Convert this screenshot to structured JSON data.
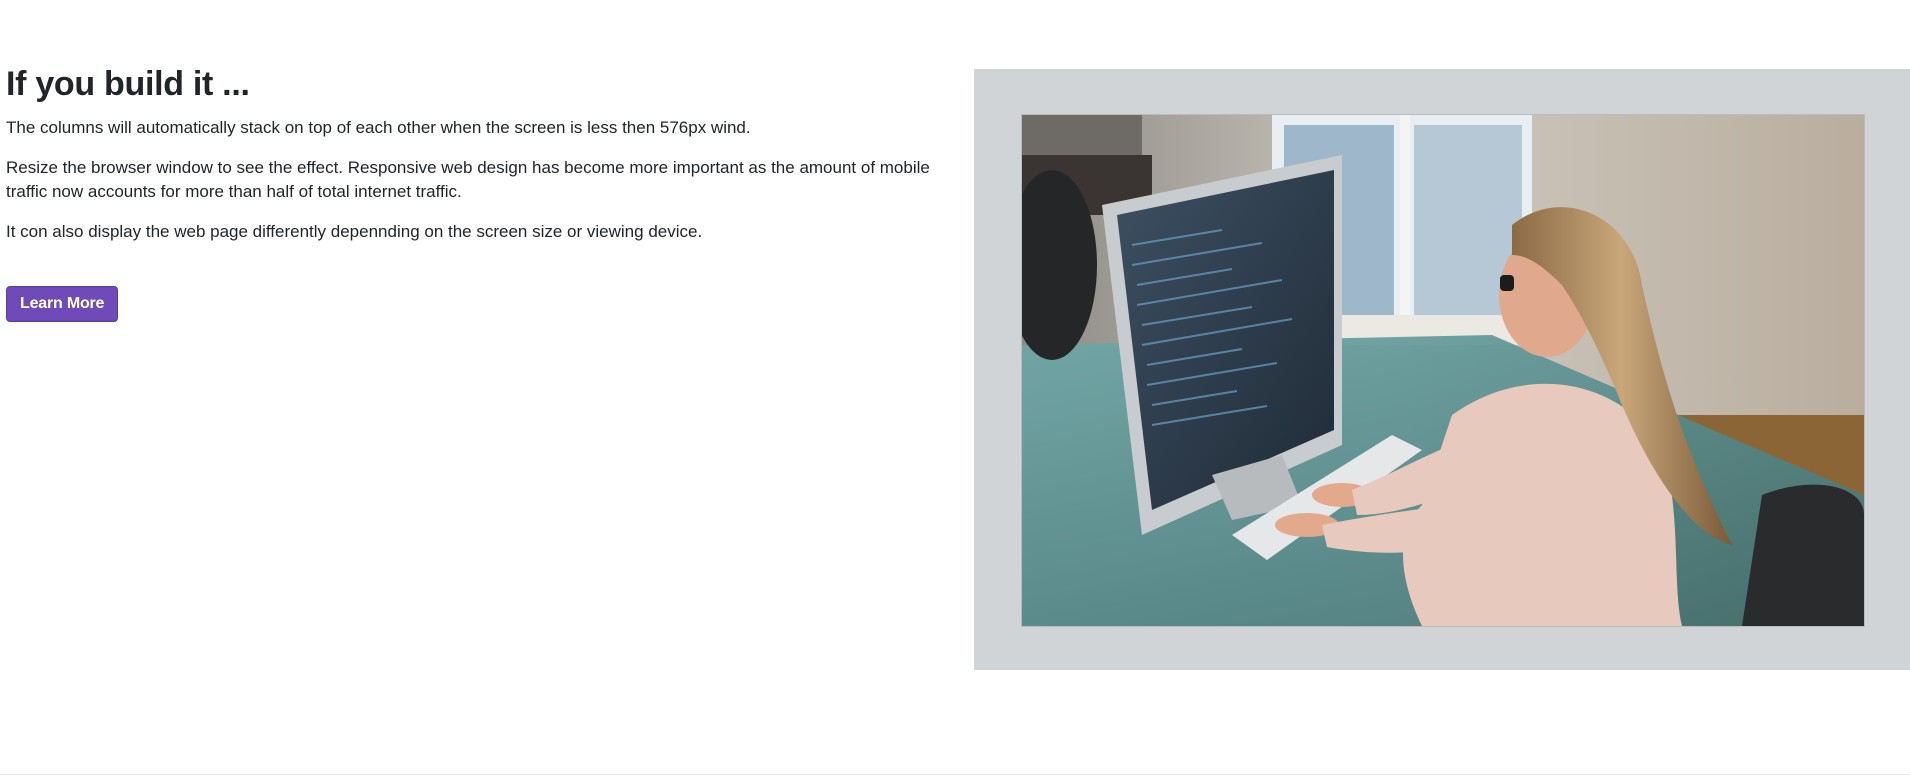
{
  "content": {
    "heading": "If you build it ...",
    "paragraphs": [
      "The columns will automatically stack on top of each other when the screen is less then 576px wind.",
      "Resize the browser window to see the effect. Responsive web design has become more important as the amount of mobile traffic now accounts for more than half of total internet traffic.",
      "It con also display the web page differently depennding on the screen size or viewing device."
    ],
    "button_label": "Learn More"
  },
  "image": {
    "subject": "woman typing on a desktop computer at a glass desk"
  },
  "colors": {
    "accent": "#6f4ab8",
    "frame_background": "#d0d4d7",
    "text": "#212529"
  }
}
